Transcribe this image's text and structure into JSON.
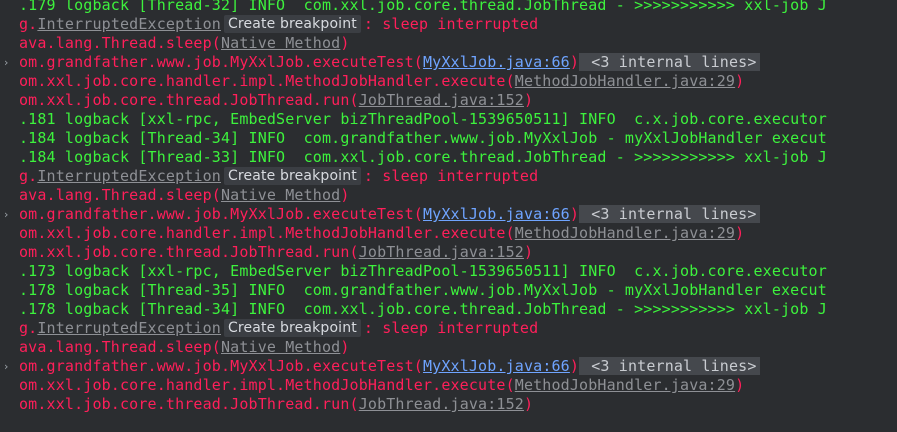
{
  "console": {
    "lines": [
      {
        "parts": [
          {
            "t": ".179 logback [Thread-32] INFO  com.xxl.job.core.thread.JobThread - >>>>>>>>>>> xxl-job J",
            "c": "info"
          }
        ]
      },
      {
        "parts": [
          {
            "t": "g.",
            "c": "err"
          },
          {
            "t": "InterruptedException",
            "c": "muted"
          },
          {
            "t": "Create breakpoint",
            "c": "badge"
          },
          {
            "t": ": sleep interrupted",
            "c": "err"
          }
        ]
      },
      {
        "parts": [
          {
            "t": "ava.lang.Thread.sleep(",
            "c": "err"
          },
          {
            "t": "Native Method",
            "c": "muted"
          },
          {
            "t": ")",
            "c": "err"
          }
        ]
      },
      {
        "fold": true,
        "parts": [
          {
            "t": "om.grandfather.www.job.MyXxlJob.executeTest(",
            "c": "err"
          },
          {
            "t": "MyXxlJob.java:66",
            "c": "link"
          },
          {
            "t": ")",
            "c": "err"
          },
          {
            "t": " <3 internal lines>",
            "c": "highlight"
          }
        ]
      },
      {
        "parts": [
          {
            "t": "om.xxl.job.core.handler.impl.MethodJobHandler.execute(",
            "c": "err"
          },
          {
            "t": "MethodJobHandler.java:29",
            "c": "muted"
          },
          {
            "t": ")",
            "c": "err"
          }
        ]
      },
      {
        "parts": [
          {
            "t": "om.xxl.job.core.thread.JobThread.run(",
            "c": "err"
          },
          {
            "t": "JobThread.java:152",
            "c": "muted"
          },
          {
            "t": ")",
            "c": "err"
          }
        ]
      },
      {
        "parts": [
          {
            "t": ".181 logback [xxl-rpc, EmbedServer bizThreadPool-1539650511] INFO  c.x.job.core.executor",
            "c": "info"
          }
        ]
      },
      {
        "parts": [
          {
            "t": ".184 logback [Thread-34] INFO  com.grandfather.www.job.MyXxlJob - myXxlJobHandler execut",
            "c": "info"
          }
        ]
      },
      {
        "parts": [
          {
            "t": ".184 logback [Thread-33] INFO  com.xxl.job.core.thread.JobThread - >>>>>>>>>>> xxl-job J",
            "c": "info"
          }
        ]
      },
      {
        "parts": [
          {
            "t": "g.",
            "c": "err"
          },
          {
            "t": "InterruptedException",
            "c": "muted"
          },
          {
            "t": "Create breakpoint",
            "c": "badge"
          },
          {
            "t": ": sleep interrupted",
            "c": "err"
          }
        ]
      },
      {
        "parts": [
          {
            "t": "ava.lang.Thread.sleep(",
            "c": "err"
          },
          {
            "t": "Native Method",
            "c": "muted"
          },
          {
            "t": ")",
            "c": "err"
          }
        ]
      },
      {
        "fold": true,
        "parts": [
          {
            "t": "om.grandfather.www.job.MyXxlJob.executeTest(",
            "c": "err"
          },
          {
            "t": "MyXxlJob.java:66",
            "c": "link"
          },
          {
            "t": ")",
            "c": "err"
          },
          {
            "t": " <3 internal lines>",
            "c": "highlight"
          }
        ]
      },
      {
        "parts": [
          {
            "t": "om.xxl.job.core.handler.impl.MethodJobHandler.execute(",
            "c": "err"
          },
          {
            "t": "MethodJobHandler.java:29",
            "c": "muted"
          },
          {
            "t": ")",
            "c": "err"
          }
        ]
      },
      {
        "parts": [
          {
            "t": "om.xxl.job.core.thread.JobThread.run(",
            "c": "err"
          },
          {
            "t": "JobThread.java:152",
            "c": "muted"
          },
          {
            "t": ")",
            "c": "err"
          }
        ]
      },
      {
        "parts": [
          {
            "t": ".173 logback [xxl-rpc, EmbedServer bizThreadPool-1539650511] INFO  c.x.job.core.executor",
            "c": "info"
          }
        ]
      },
      {
        "parts": [
          {
            "t": ".178 logback [Thread-35] INFO  com.grandfather.www.job.MyXxlJob - myXxlJobHandler execut",
            "c": "info"
          }
        ]
      },
      {
        "parts": [
          {
            "t": ".178 logback [Thread-34] INFO  com.xxl.job.core.thread.JobThread - >>>>>>>>>>> xxl-job J",
            "c": "info"
          }
        ]
      },
      {
        "parts": [
          {
            "t": "g.",
            "c": "err"
          },
          {
            "t": "InterruptedException",
            "c": "muted"
          },
          {
            "t": "Create breakpoint",
            "c": "badge"
          },
          {
            "t": ": sleep interrupted",
            "c": "err"
          }
        ]
      },
      {
        "parts": [
          {
            "t": "ava.lang.Thread.sleep(",
            "c": "err"
          },
          {
            "t": "Native Method",
            "c": "muted"
          },
          {
            "t": ")",
            "c": "err"
          }
        ]
      },
      {
        "fold": true,
        "parts": [
          {
            "t": "om.grandfather.www.job.MyXxlJob.executeTest(",
            "c": "err"
          },
          {
            "t": "MyXxlJob.java:66",
            "c": "link"
          },
          {
            "t": ")",
            "c": "err"
          },
          {
            "t": " <3 internal lines>",
            "c": "highlight"
          }
        ]
      },
      {
        "parts": [
          {
            "t": "om.xxl.job.core.handler.impl.MethodJobHandler.execute(",
            "c": "err"
          },
          {
            "t": "MethodJobHandler.java:29",
            "c": "muted"
          },
          {
            "t": ")",
            "c": "err"
          }
        ]
      },
      {
        "parts": [
          {
            "t": "om.xxl.job.core.thread.JobThread.run(",
            "c": "err"
          },
          {
            "t": "JobThread.java:152",
            "c": "muted"
          },
          {
            "t": ")",
            "c": "err"
          }
        ]
      }
    ],
    "fold_glyph": "›",
    "colors": {
      "background": "#2b2d30",
      "error": "#ff1f5a",
      "info": "#3df23d",
      "link": "#6fa4ff",
      "muted": "#8e9095",
      "badge_bg": "#3b3e43",
      "highlight_bg": "#45484d"
    }
  }
}
